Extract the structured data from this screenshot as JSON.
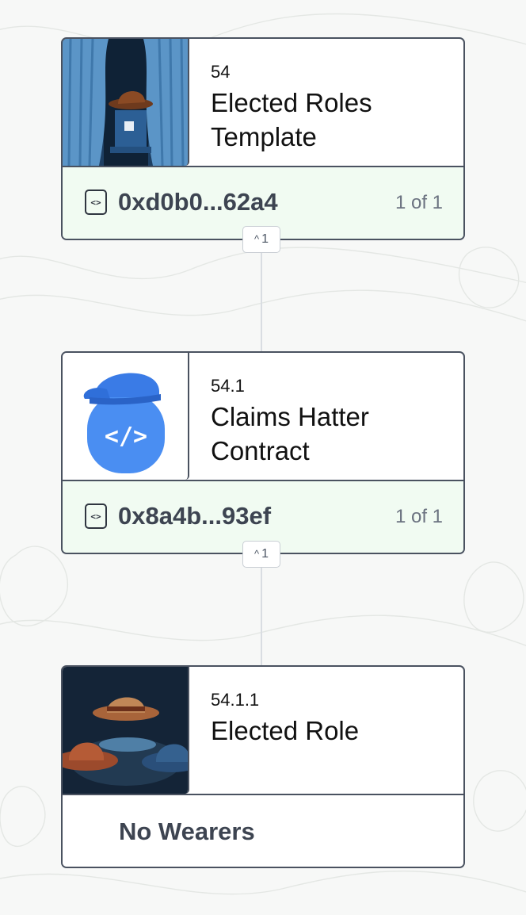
{
  "hats": [
    {
      "id": "54",
      "name": "Elected Roles Template",
      "image": "curtain-voting-booth-hat-image",
      "wearer": {
        "address": "0xd0b0...62a4",
        "count": "1 of 1"
      },
      "children_toggle": {
        "glyph": "^",
        "count": "1"
      }
    },
    {
      "id": "54.1",
      "name": "Claims Hatter Contract",
      "image": "code-cap-icon",
      "icon_text": "</>",
      "wearer": {
        "address": "0x8a4b...93ef",
        "count": "1 of 1"
      },
      "children_toggle": {
        "glyph": "^",
        "count": "1"
      }
    },
    {
      "id": "54.1.1",
      "name": "Elected Role",
      "image": "three-hats-image",
      "wearer_status": "No Wearers"
    }
  ],
  "icons": {
    "address": "code-icon",
    "address_glyph": "<>"
  },
  "colors": {
    "card_border": "#4a5260",
    "wearer_bg": "#f1fbf2",
    "code_blue": "#4a8ef2"
  }
}
